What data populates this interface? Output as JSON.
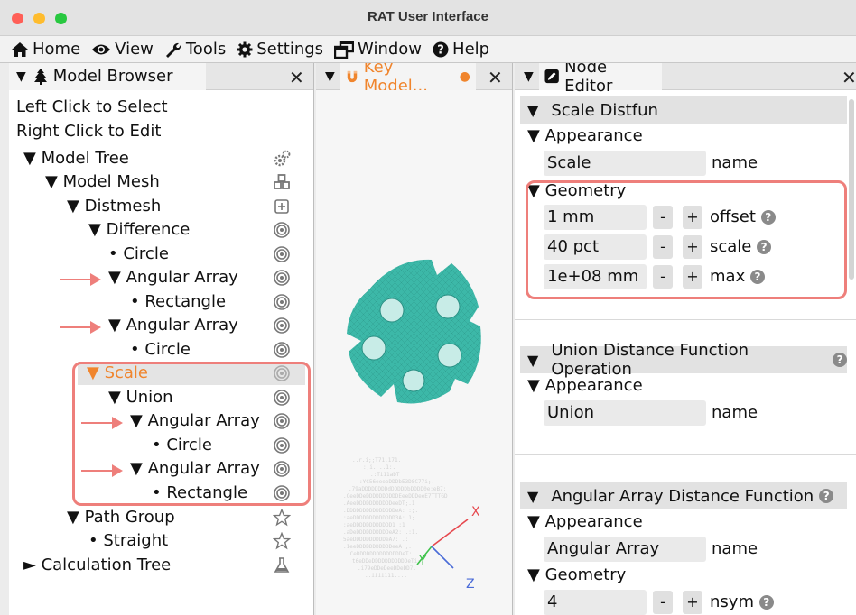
{
  "window": {
    "title": "RAT User Interface"
  },
  "menu": [
    {
      "label": "Home",
      "icon": "home-icon"
    },
    {
      "label": "View",
      "icon": "eye-icon"
    },
    {
      "label": "Tools",
      "icon": "wrench-icon"
    },
    {
      "label": "Settings",
      "icon": "gear-icon"
    },
    {
      "label": "Window",
      "icon": "window-icon"
    },
    {
      "label": "Help",
      "icon": "help-icon"
    }
  ],
  "model_browser": {
    "tab_label": "Model Browser",
    "hint_select": "Left Click to Select",
    "hint_edit": "Right Click to Edit",
    "tree": [
      {
        "label": "Model Tree",
        "marker": "▼"
      },
      {
        "label": "Model Mesh",
        "marker": "▼"
      },
      {
        "label": "Distmesh",
        "marker": "▼"
      },
      {
        "label": "Difference",
        "marker": "▼"
      },
      {
        "label": "Circle",
        "marker": "•"
      },
      {
        "label": "Angular Array",
        "marker": "▼"
      },
      {
        "label": "Rectangle",
        "marker": "•"
      },
      {
        "label": "Angular Array",
        "marker": "▼"
      },
      {
        "label": "Circle",
        "marker": "•"
      },
      {
        "label": "Scale",
        "marker": "▼"
      },
      {
        "label": "Union",
        "marker": "▼"
      },
      {
        "label": "Angular Array",
        "marker": "▼"
      },
      {
        "label": "Circle",
        "marker": "•"
      },
      {
        "label": "Angular Array",
        "marker": "▼"
      },
      {
        "label": "Rectangle",
        "marker": "•"
      },
      {
        "label": "Path Group",
        "marker": "▼"
      },
      {
        "label": "Straight",
        "marker": "•"
      },
      {
        "label": "Calculation Tree",
        "marker": "►"
      }
    ]
  },
  "key_model": {
    "tab_label": "Key Model...",
    "axis_x": "X",
    "axis_y": "Y",
    "axis_z": "Z"
  },
  "node_editor": {
    "tab_label": "Node Editor",
    "scale": {
      "title": "Scale Distfun",
      "appearance_label": "Appearance",
      "name_value": "Scale",
      "name_label": "name",
      "geometry_label": "Geometry",
      "offset_value": "1 mm",
      "offset_label": "offset",
      "scale_value": "40 pct",
      "scale_label": "scale",
      "max_value": "1e+08 mm",
      "max_label": "max"
    },
    "union": {
      "title": "Union Distance Function Operation",
      "appearance_label": "Appearance",
      "name_value": "Union",
      "name_label": "name"
    },
    "angular": {
      "title": "Angular Array Distance Function",
      "appearance_label": "Appearance",
      "name_value": "Angular Array",
      "name_label": "name",
      "geometry_label": "Geometry",
      "nsym_value": "4",
      "nsym_label": "nsym"
    },
    "minus": "-",
    "plus": "+"
  },
  "colors": {
    "accent": "#f0852d",
    "highlight": "#ee7f7b",
    "mesh": "#3cb8a8"
  }
}
